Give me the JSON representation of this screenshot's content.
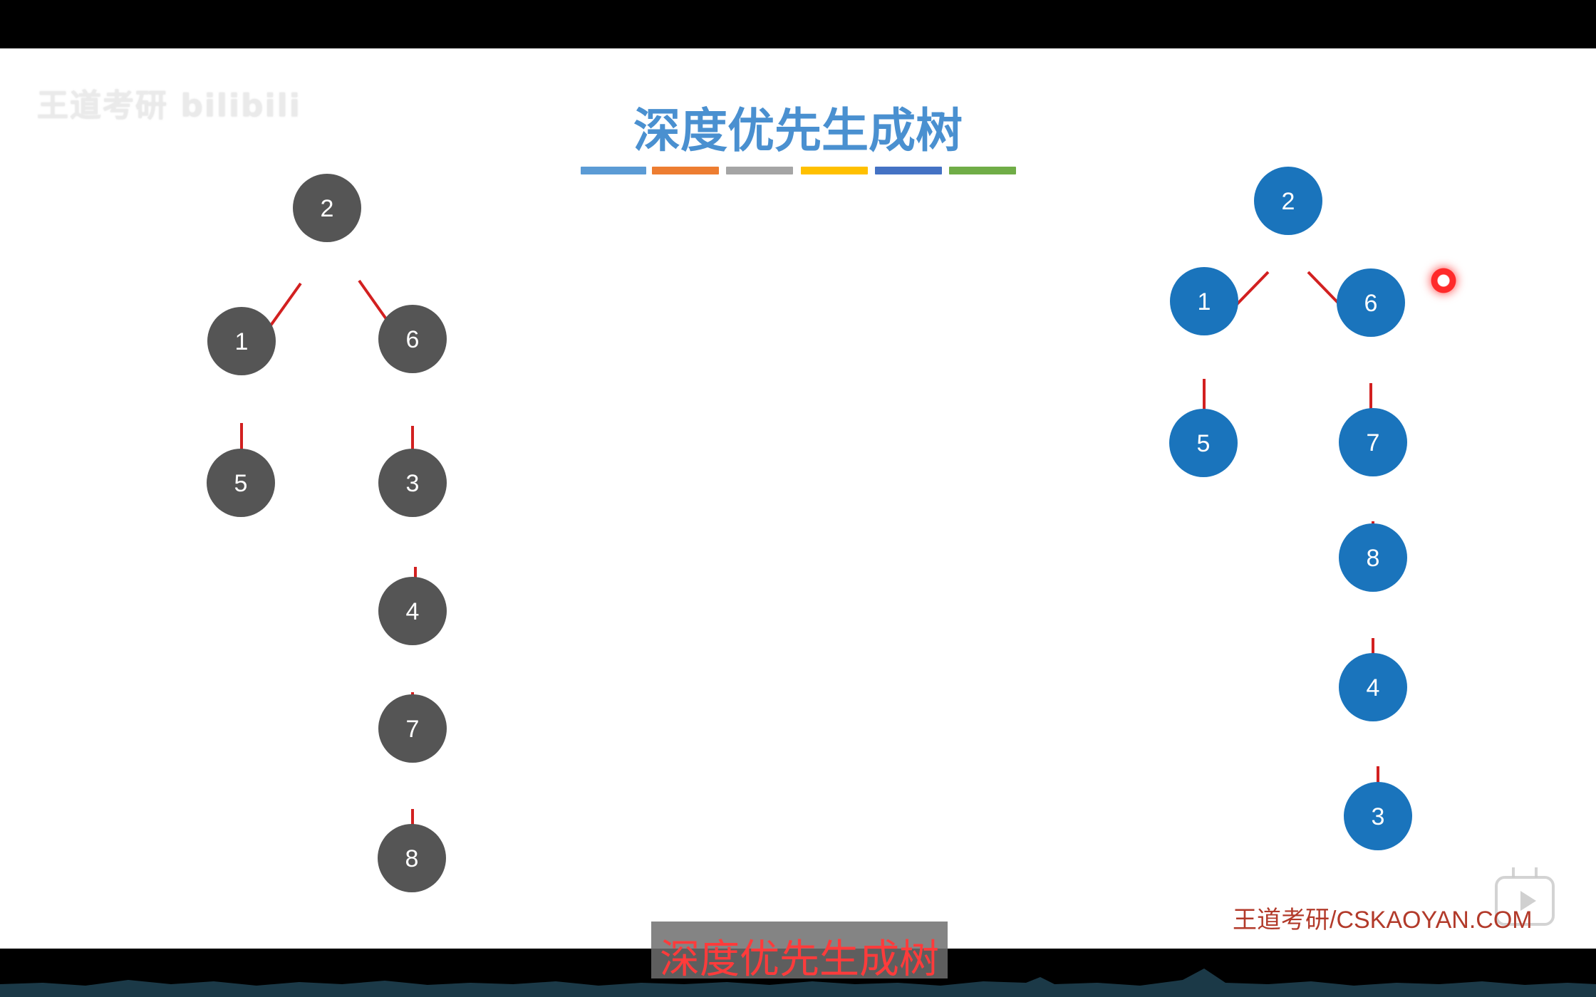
{
  "watermark": "王道考研 bilibili",
  "title": "深度优先生成树",
  "title_bar_colors": [
    "#5b9bd5",
    "#ed7d31",
    "#a5a5a5",
    "#ffc000",
    "#4472c4",
    "#70ad47"
  ],
  "tree_left": {
    "node_color": "#555555",
    "edge_color": "#d22020",
    "labels": [
      "2",
      "1",
      "6",
      "5",
      "3",
      "4",
      "7",
      "8"
    ]
  },
  "tree_right": {
    "node_color": "#1a74bc",
    "edge_color": "#d22020",
    "labels": [
      "2",
      "1",
      "6",
      "5",
      "7",
      "8",
      "4",
      "3"
    ]
  },
  "credit": "王道考研/CSKAOYAN.COM",
  "subtitle": "深度优先生成树"
}
